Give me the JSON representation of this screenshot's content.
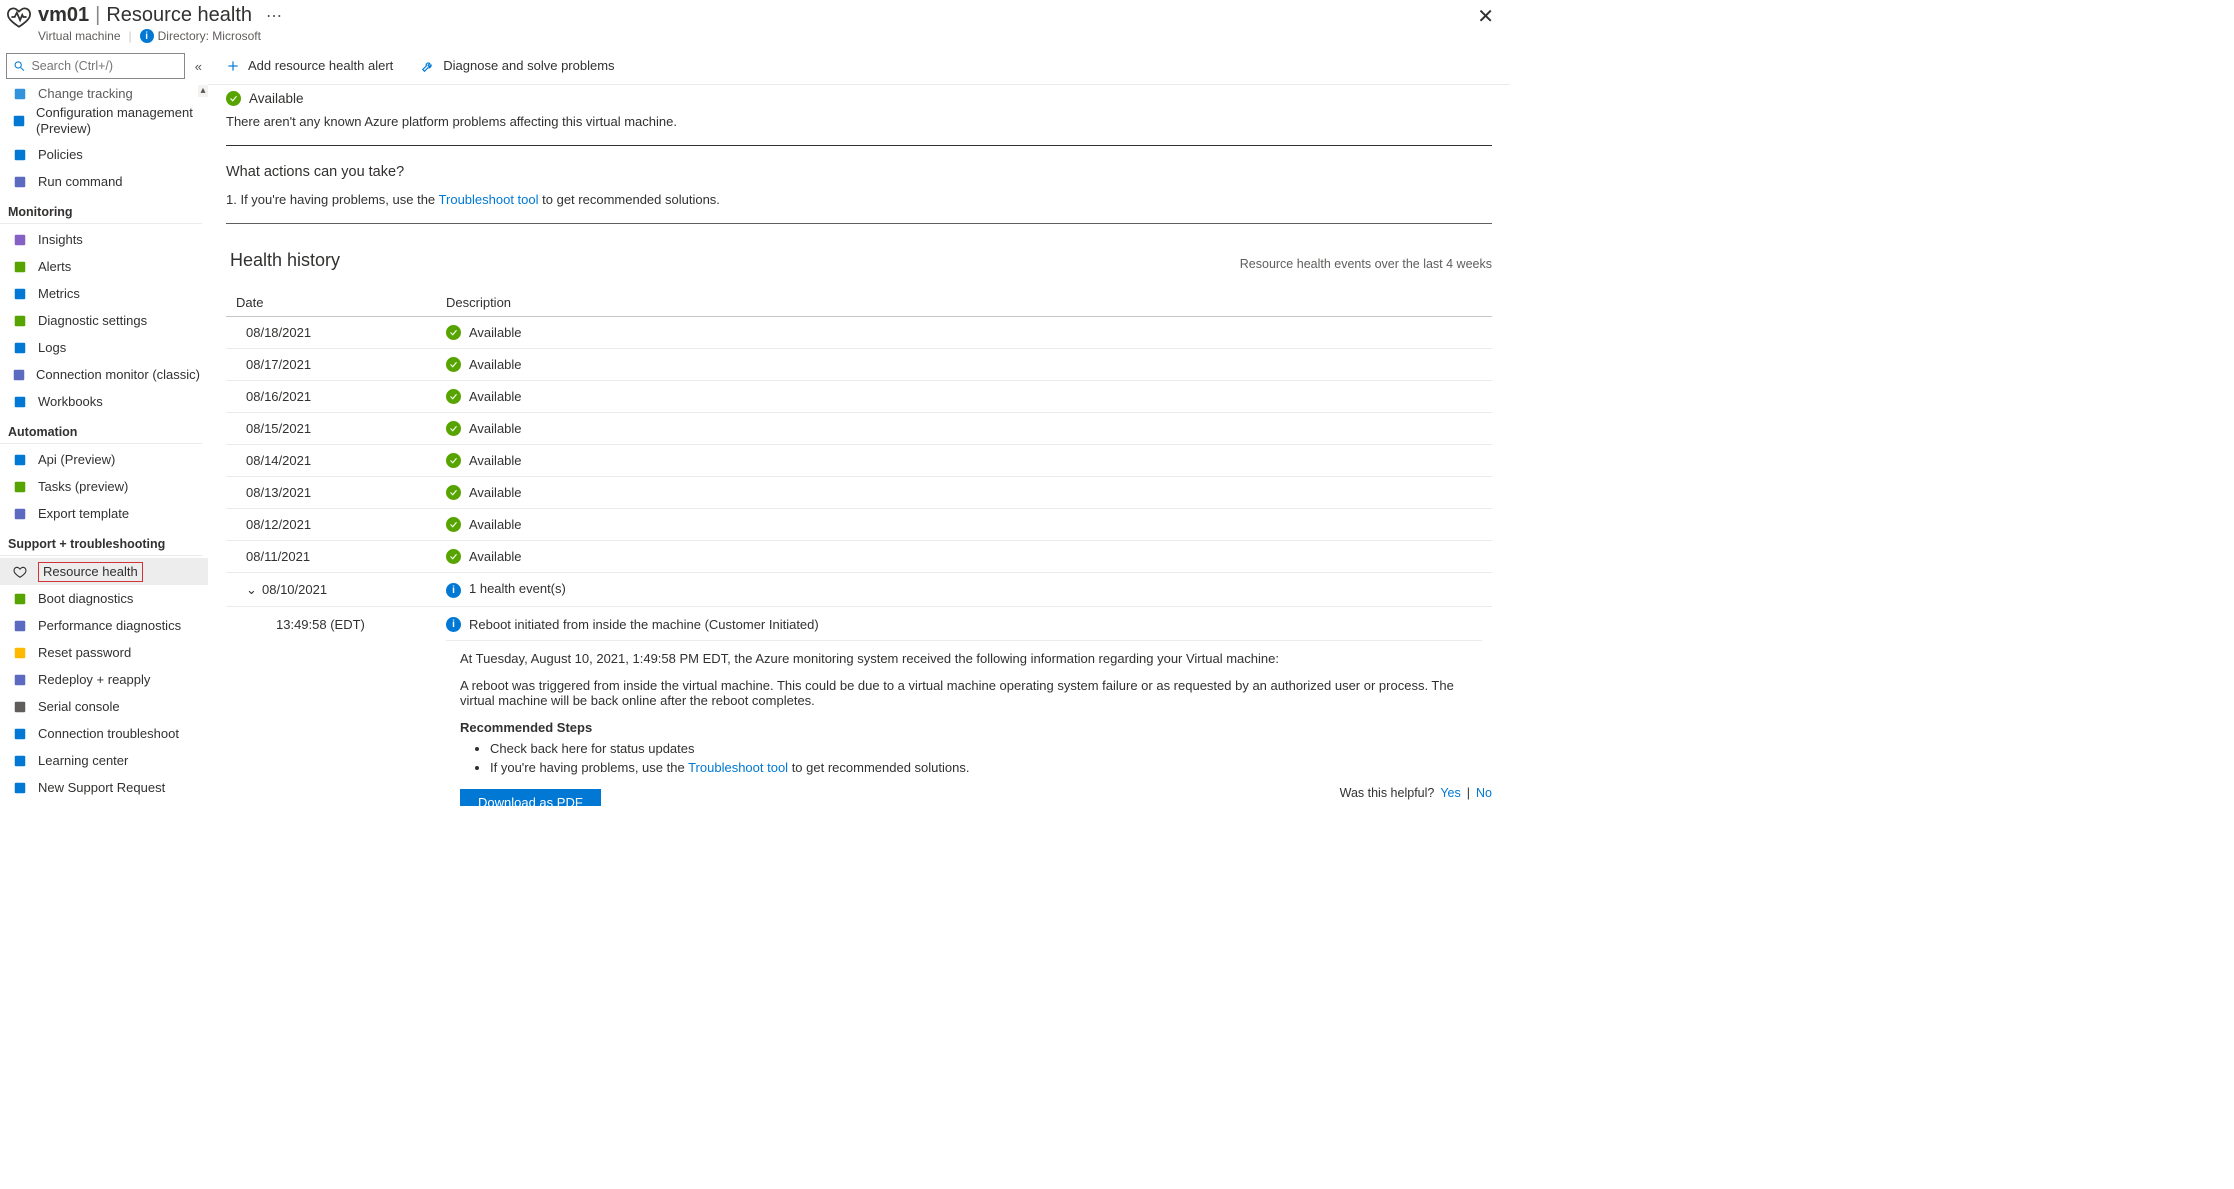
{
  "header": {
    "vm_name": "vm01",
    "separator": "|",
    "page_title": "Resource health",
    "subtitle_type": "Virtual machine",
    "directory_label": "Directory: Microsoft"
  },
  "search": {
    "placeholder": "Search (Ctrl+/)"
  },
  "sidebar": {
    "items_top": [
      {
        "id": "change-tracking",
        "label": "Change tracking",
        "color": "#0078d4",
        "cut": true
      },
      {
        "id": "config-mgmt",
        "label": "Configuration management (Preview)",
        "color": "#0078d4",
        "multi": true
      },
      {
        "id": "policies",
        "label": "Policies",
        "color": "#0078d4"
      },
      {
        "id": "run-command",
        "label": "Run command",
        "color": "#5c6bc0"
      }
    ],
    "group_monitoring": "Monitoring",
    "items_monitoring": [
      {
        "id": "insights",
        "label": "Insights",
        "color": "#8661c5"
      },
      {
        "id": "alerts",
        "label": "Alerts",
        "color": "#57a300"
      },
      {
        "id": "metrics",
        "label": "Metrics",
        "color": "#0078d4"
      },
      {
        "id": "diag-settings",
        "label": "Diagnostic settings",
        "color": "#57a300"
      },
      {
        "id": "logs",
        "label": "Logs",
        "color": "#0078d4"
      },
      {
        "id": "conn-monitor",
        "label": "Connection monitor (classic)",
        "color": "#5c6bc0"
      },
      {
        "id": "workbooks",
        "label": "Workbooks",
        "color": "#0078d4"
      }
    ],
    "group_automation": "Automation",
    "items_automation": [
      {
        "id": "api-preview",
        "label": "Api (Preview)",
        "color": "#0078d4"
      },
      {
        "id": "tasks-preview",
        "label": "Tasks (preview)",
        "color": "#57a300"
      },
      {
        "id": "export-template",
        "label": "Export template",
        "color": "#5c6bc0"
      }
    ],
    "group_support": "Support + troubleshooting",
    "items_support": [
      {
        "id": "resource-health",
        "label": "Resource health",
        "color": "#323130",
        "selected": true
      },
      {
        "id": "boot-diag",
        "label": "Boot diagnostics",
        "color": "#57a300"
      },
      {
        "id": "perf-diag",
        "label": "Performance diagnostics",
        "color": "#5c6bc0"
      },
      {
        "id": "reset-pwd",
        "label": "Reset password",
        "color": "#ffb900"
      },
      {
        "id": "redeploy",
        "label": "Redeploy + reapply",
        "color": "#5c6bc0"
      },
      {
        "id": "serial-console",
        "label": "Serial console",
        "color": "#605e5c"
      },
      {
        "id": "conn-troubleshoot",
        "label": "Connection troubleshoot",
        "color": "#0078d4"
      },
      {
        "id": "learning-center",
        "label": "Learning center",
        "color": "#0078d4"
      },
      {
        "id": "new-support",
        "label": "New Support Request",
        "color": "#0078d4"
      }
    ]
  },
  "commands": {
    "add_alert": "Add resource health alert",
    "diagnose": "Diagnose and solve problems"
  },
  "status": {
    "state": "Available",
    "description": "There aren't any known Azure platform problems affecting this virtual machine."
  },
  "actions": {
    "heading": "What actions can you take?",
    "step_prefix": "1.   If you're having problems, use the ",
    "step_link": "Troubleshoot tool",
    "step_suffix": " to get recommended solutions."
  },
  "history": {
    "title": "Health history",
    "subtitle": "Resource health events over the last 4 weeks",
    "col_date": "Date",
    "col_desc": "Description",
    "rows": [
      {
        "date": "08/18/2021",
        "status": "Available"
      },
      {
        "date": "08/17/2021",
        "status": "Available"
      },
      {
        "date": "08/16/2021",
        "status": "Available"
      },
      {
        "date": "08/15/2021",
        "status": "Available"
      },
      {
        "date": "08/14/2021",
        "status": "Available"
      },
      {
        "date": "08/13/2021",
        "status": "Available"
      },
      {
        "date": "08/12/2021",
        "status": "Available"
      },
      {
        "date": "08/11/2021",
        "status": "Available"
      }
    ],
    "expanded": {
      "date": "08/10/2021",
      "summary": "1 health event(s)"
    }
  },
  "detail": {
    "time": "13:49:58 (EDT)",
    "title": "Reboot initiated from inside the machine (Customer Initiated)",
    "p1": "At Tuesday, August 10, 2021, 1:49:58 PM EDT, the Azure monitoring system received the following information regarding your Virtual machine:",
    "p2": "A reboot was triggered from inside the virtual machine. This could be due to a virtual machine operating system failure or as requested by an authorized user or process. The virtual machine will be back online after the reboot completes.",
    "rec_heading": "Recommended Steps",
    "rec1": "Check back here for status updates",
    "rec2_prefix": "If you're having problems, use the ",
    "rec2_link": "Troubleshoot tool",
    "rec2_suffix": " to get recommended solutions.",
    "pdf_label": "Download as PDF"
  },
  "feedback": {
    "q": "Was this helpful?",
    "yes": "Yes",
    "no": "No"
  }
}
